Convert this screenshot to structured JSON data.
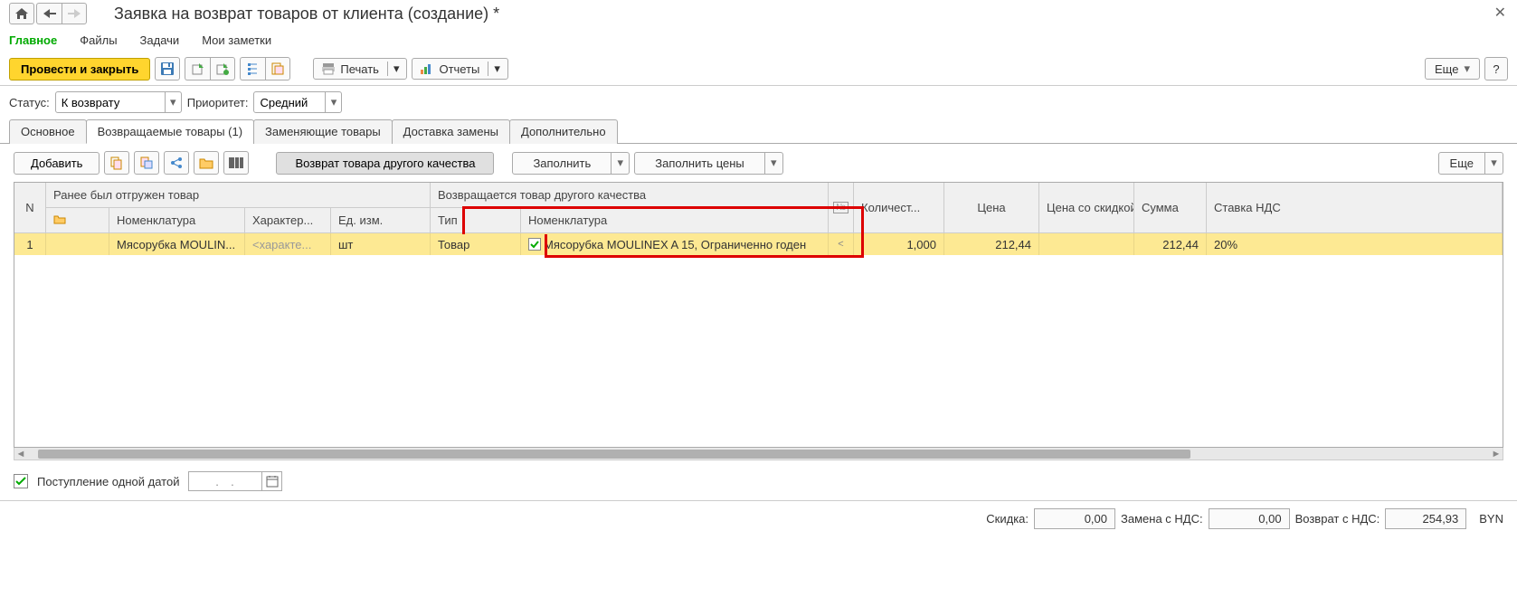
{
  "header": {
    "title": "Заявка на возврат товаров от клиента (создание) *"
  },
  "nav_tabs": {
    "main": "Главное",
    "files": "Файлы",
    "tasks": "Задачи",
    "notes": "Мои заметки"
  },
  "toolbar": {
    "post_close": "Провести и закрыть",
    "print": "Печать",
    "reports": "Отчеты",
    "more": "Еще",
    "help": "?"
  },
  "status_bar": {
    "status_label": "Статус:",
    "status_value": "К возврату",
    "priority_label": "Приоритет:",
    "priority_value": "Средний"
  },
  "main_tabs": {
    "basic": "Основное",
    "returned": "Возвращаемые товары (1)",
    "replacing": "Заменяющие товары",
    "delivery": "Доставка замены",
    "additional": "Дополнительно"
  },
  "inner_toolbar": {
    "add": "Добавить",
    "return_other": "Возврат товара другого качества",
    "fill": "Заполнить",
    "fill_prices": "Заполнить цены",
    "more": "Еще"
  },
  "grid": {
    "headers": {
      "n": "N",
      "shipped": "Ранее был отгружен товар",
      "returned_other": "Возвращается товар другого качества",
      "icon": "",
      "nomenclature": "Номенклатура",
      "characteristic": "Характер...",
      "unit": "Ед. изм.",
      "type": "Тип",
      "nomenclature2": "Номенклатура",
      "flag": "№",
      "quantity": "Количест...",
      "price": "Цена",
      "price_discount": "Цена со скидкой",
      "sum": "Сумма",
      "vat": "Ставка НДС"
    },
    "row": {
      "n": "1",
      "nomenclature": "Мясорубка MOULIN...",
      "characteristic": "<характе...",
      "unit": "шт",
      "type": "Товар",
      "nomenclature2": "Мясорубка MOULINEX  A 15, Ограниченно годен",
      "lt": "<",
      "quantity": "1,000",
      "price": "212,44",
      "price_discount": "",
      "sum": "212,44",
      "vat": "20%"
    }
  },
  "footer": {
    "single_date_label": "Поступление одной датой",
    "date_value": ".  .",
    "discount_label": "Скидка:",
    "discount_value": "0,00",
    "replace_label": "Замена с НДС:",
    "replace_value": "0,00",
    "return_label": "Возврат с НДС:",
    "return_value": "254,93",
    "currency": "BYN"
  }
}
